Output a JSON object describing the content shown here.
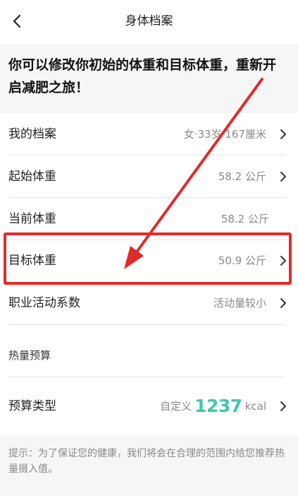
{
  "header": {
    "title": "身体档案"
  },
  "intro": {
    "text": "你可以修改你初始的体重和目标体重，重新开启减肥之旅！"
  },
  "rows": [
    {
      "label": "我的档案",
      "value": "女·33岁 167厘米"
    },
    {
      "label": "起始体重",
      "value": "58.2 公斤"
    },
    {
      "label": "当前体重",
      "value": "58.2 公斤"
    },
    {
      "label": "目标体重",
      "value": "50.9 公斤"
    },
    {
      "label": "职业活动系数",
      "value": "活动量较小"
    }
  ],
  "budget": {
    "section_label": "热量预算",
    "label": "预算类型",
    "prefix": "自定义",
    "number": "1237",
    "unit": "kcal"
  },
  "tip": {
    "text": "提示：为了保证您的健康，我们将会在合理的范围内给您推荐热量摄入值。"
  },
  "colors": {
    "accent": "#3fc8b0",
    "annotation": "#e02b2b"
  }
}
